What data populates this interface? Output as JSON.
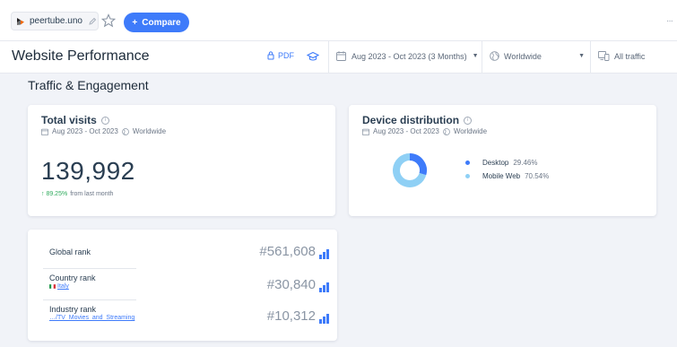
{
  "topbar": {
    "site": "peertube.uno",
    "compare_label": "Compare"
  },
  "header": {
    "title": "Website Performance",
    "pdf_label": "PDF",
    "date_range": "Aug 2023 - Oct 2023 (3 Months)",
    "country": "Worldwide",
    "traffic": "All traffic"
  },
  "section": {
    "title": "Traffic & Engagement"
  },
  "total_visits": {
    "title": "Total visits",
    "date": "Aug 2023 - Oct 2023",
    "region": "Worldwide",
    "value": "139,992",
    "change": "↑ 89.25%",
    "change_note": "from last month"
  },
  "device_distribution": {
    "title": "Device distribution",
    "date": "Aug 2023 - Oct 2023",
    "region": "Worldwide",
    "items": [
      {
        "label": "Desktop",
        "value": "29.46%",
        "share": 29.46,
        "color": "#3e7bfa"
      },
      {
        "label": "Mobile Web",
        "value": "70.54%",
        "share": 70.54,
        "color": "#8fd0f5"
      }
    ]
  },
  "ranks": {
    "global": {
      "label": "Global rank",
      "value": "#561,608"
    },
    "country": {
      "label": "Country rank",
      "sub": "Italy",
      "value": "#30,840"
    },
    "industry": {
      "label": "Industry rank",
      "sub": "…/TV_Movies_and_Streaming",
      "value": "#10,312"
    }
  },
  "colors": {
    "accent": "#3e7bfa",
    "positive": "#2eaa5c"
  }
}
